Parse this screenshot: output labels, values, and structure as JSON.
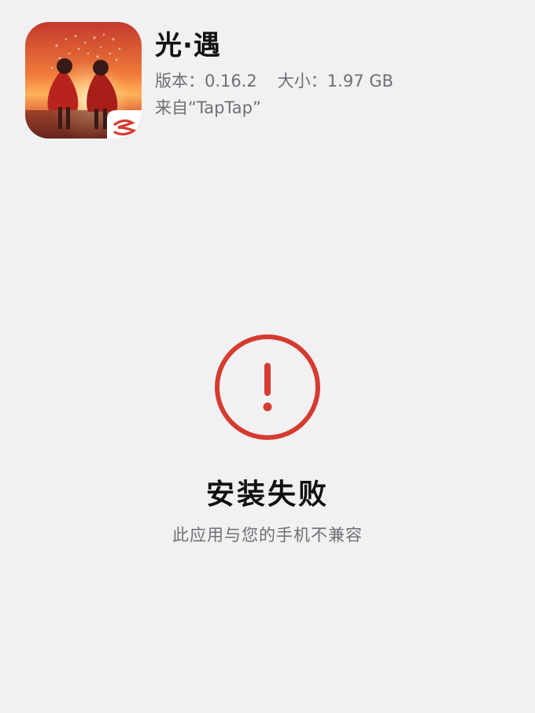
{
  "app": {
    "name": "光·遇",
    "version_label": "版本：",
    "version_value": "0.16.2",
    "size_label": "大小：",
    "size_value": "1.97 GB",
    "source_text": "来自“TapTap”",
    "icon": "sky-game-icon",
    "badge_icon": "netease-logo-icon"
  },
  "result": {
    "icon": "exclamation-circle-icon",
    "title": "安装失败",
    "description": "此应用与您的手机不兼容"
  },
  "colors": {
    "background": "#f1f1f3",
    "error_red": "#d63b30",
    "text_primary": "#111111",
    "text_secondary": "#6f6f73"
  }
}
